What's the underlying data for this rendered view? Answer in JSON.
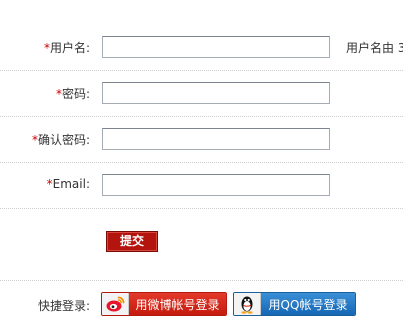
{
  "form": {
    "fields": [
      {
        "required_mark": "*",
        "label": "用户名:",
        "value": "",
        "hint": "用户名由 3"
      },
      {
        "required_mark": "*",
        "label": "密码:",
        "value": ""
      },
      {
        "required_mark": "*",
        "label": "确认密码:",
        "value": ""
      },
      {
        "required_mark": "*",
        "label": "Email:",
        "value": ""
      }
    ],
    "submit_label": "提交"
  },
  "quick_login": {
    "label": "快捷登录:",
    "weibo": {
      "label": "用微博帐号登录",
      "icon": "weibo-icon"
    },
    "qq": {
      "label": "用QQ帐号登录",
      "icon": "qq-penguin-icon"
    }
  },
  "colors": {
    "required": "#cc0000",
    "submit": "#b3150e",
    "weibo": "#d22a1c",
    "qq": "#2279c6"
  }
}
